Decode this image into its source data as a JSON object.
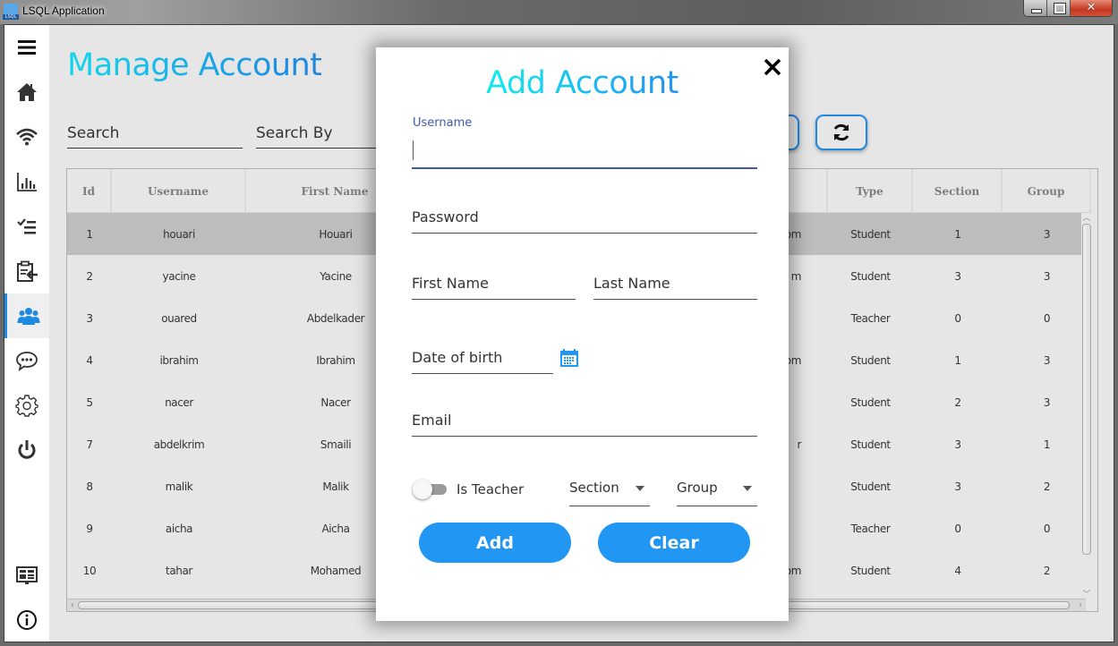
{
  "window": {
    "title": "LSQL Application",
    "controls": [
      "minimize",
      "maximize",
      "close"
    ]
  },
  "sidebar": {
    "items": [
      {
        "id": "menu",
        "icon": "hamburger-menu-icon"
      },
      {
        "id": "home",
        "icon": "home-icon"
      },
      {
        "id": "wifi",
        "icon": "wifi-icon"
      },
      {
        "id": "stats",
        "icon": "bar-chart-icon"
      },
      {
        "id": "checklist",
        "icon": "checklist-icon"
      },
      {
        "id": "clipboard",
        "icon": "clipboard-import-icon"
      },
      {
        "id": "accounts",
        "icon": "users-icon",
        "active": true
      },
      {
        "id": "chat",
        "icon": "chat-bubble-icon"
      },
      {
        "id": "settings",
        "icon": "gear-icon"
      },
      {
        "id": "power",
        "icon": "power-icon"
      },
      {
        "id": "dashboard",
        "icon": "dashboard-monitor-icon"
      },
      {
        "id": "info",
        "icon": "info-icon"
      }
    ],
    "accent": "#1e88e5"
  },
  "main": {
    "title": "Manage Account",
    "search": {
      "placeholder": "Search",
      "value": ""
    },
    "search_by": {
      "placeholder": "Search By",
      "value": ""
    },
    "refresh_icon": "refresh-icon",
    "table": {
      "columns": [
        "Id",
        "Username",
        "First Name",
        "",
        "Type",
        "Section",
        "Group"
      ],
      "rows": [
        {
          "id": "1",
          "username": "houari",
          "first_name": "Houari",
          "email_fragment": "om",
          "type": "Student",
          "section": "1",
          "group": "3",
          "selected": true
        },
        {
          "id": "2",
          "username": "yacine",
          "first_name": "Yacine",
          "email_fragment": "m",
          "type": "Student",
          "section": "3",
          "group": "3"
        },
        {
          "id": "3",
          "username": "ouared",
          "first_name": "Abdelkader",
          "email_fragment": "",
          "type": "Teacher",
          "section": "0",
          "group": "0"
        },
        {
          "id": "4",
          "username": "ibrahim",
          "first_name": "Ibrahim",
          "email_fragment": "com",
          "type": "Student",
          "section": "1",
          "group": "3"
        },
        {
          "id": "5",
          "username": "nacer",
          "first_name": "Nacer",
          "email_fragment": "",
          "type": "Student",
          "section": "2",
          "group": "3"
        },
        {
          "id": "7",
          "username": "abdelkrim",
          "first_name": "Smaili",
          "email_fragment": "r",
          "type": "Student",
          "section": "3",
          "group": "1"
        },
        {
          "id": "8",
          "username": "malik",
          "first_name": "Malik",
          "email_fragment": "",
          "type": "Student",
          "section": "3",
          "group": "2"
        },
        {
          "id": "9",
          "username": "aicha",
          "first_name": "Aicha",
          "email_fragment": "",
          "type": "Teacher",
          "section": "0",
          "group": "0"
        },
        {
          "id": "10",
          "username": "tahar",
          "first_name": "Mohamed",
          "email_fragment": "om",
          "type": "Student",
          "section": "4",
          "group": "2"
        }
      ]
    }
  },
  "modal": {
    "title": "Add Account",
    "close_icon": "close-icon",
    "username": {
      "label": "Username",
      "value": ""
    },
    "password": {
      "placeholder": "Password",
      "value": ""
    },
    "first_name": {
      "placeholder": "First Name",
      "value": ""
    },
    "last_name": {
      "placeholder": "Last Name",
      "value": ""
    },
    "dob": {
      "placeholder": "Date of birth",
      "value": "",
      "icon": "calendar-icon"
    },
    "email": {
      "placeholder": "Email",
      "value": ""
    },
    "is_teacher": {
      "label": "Is Teacher",
      "checked": false
    },
    "section": {
      "placeholder": "Section"
    },
    "group": {
      "placeholder": "Group"
    },
    "add_label": "Add",
    "clear_label": "Clear",
    "button_color": "#2196f3"
  }
}
